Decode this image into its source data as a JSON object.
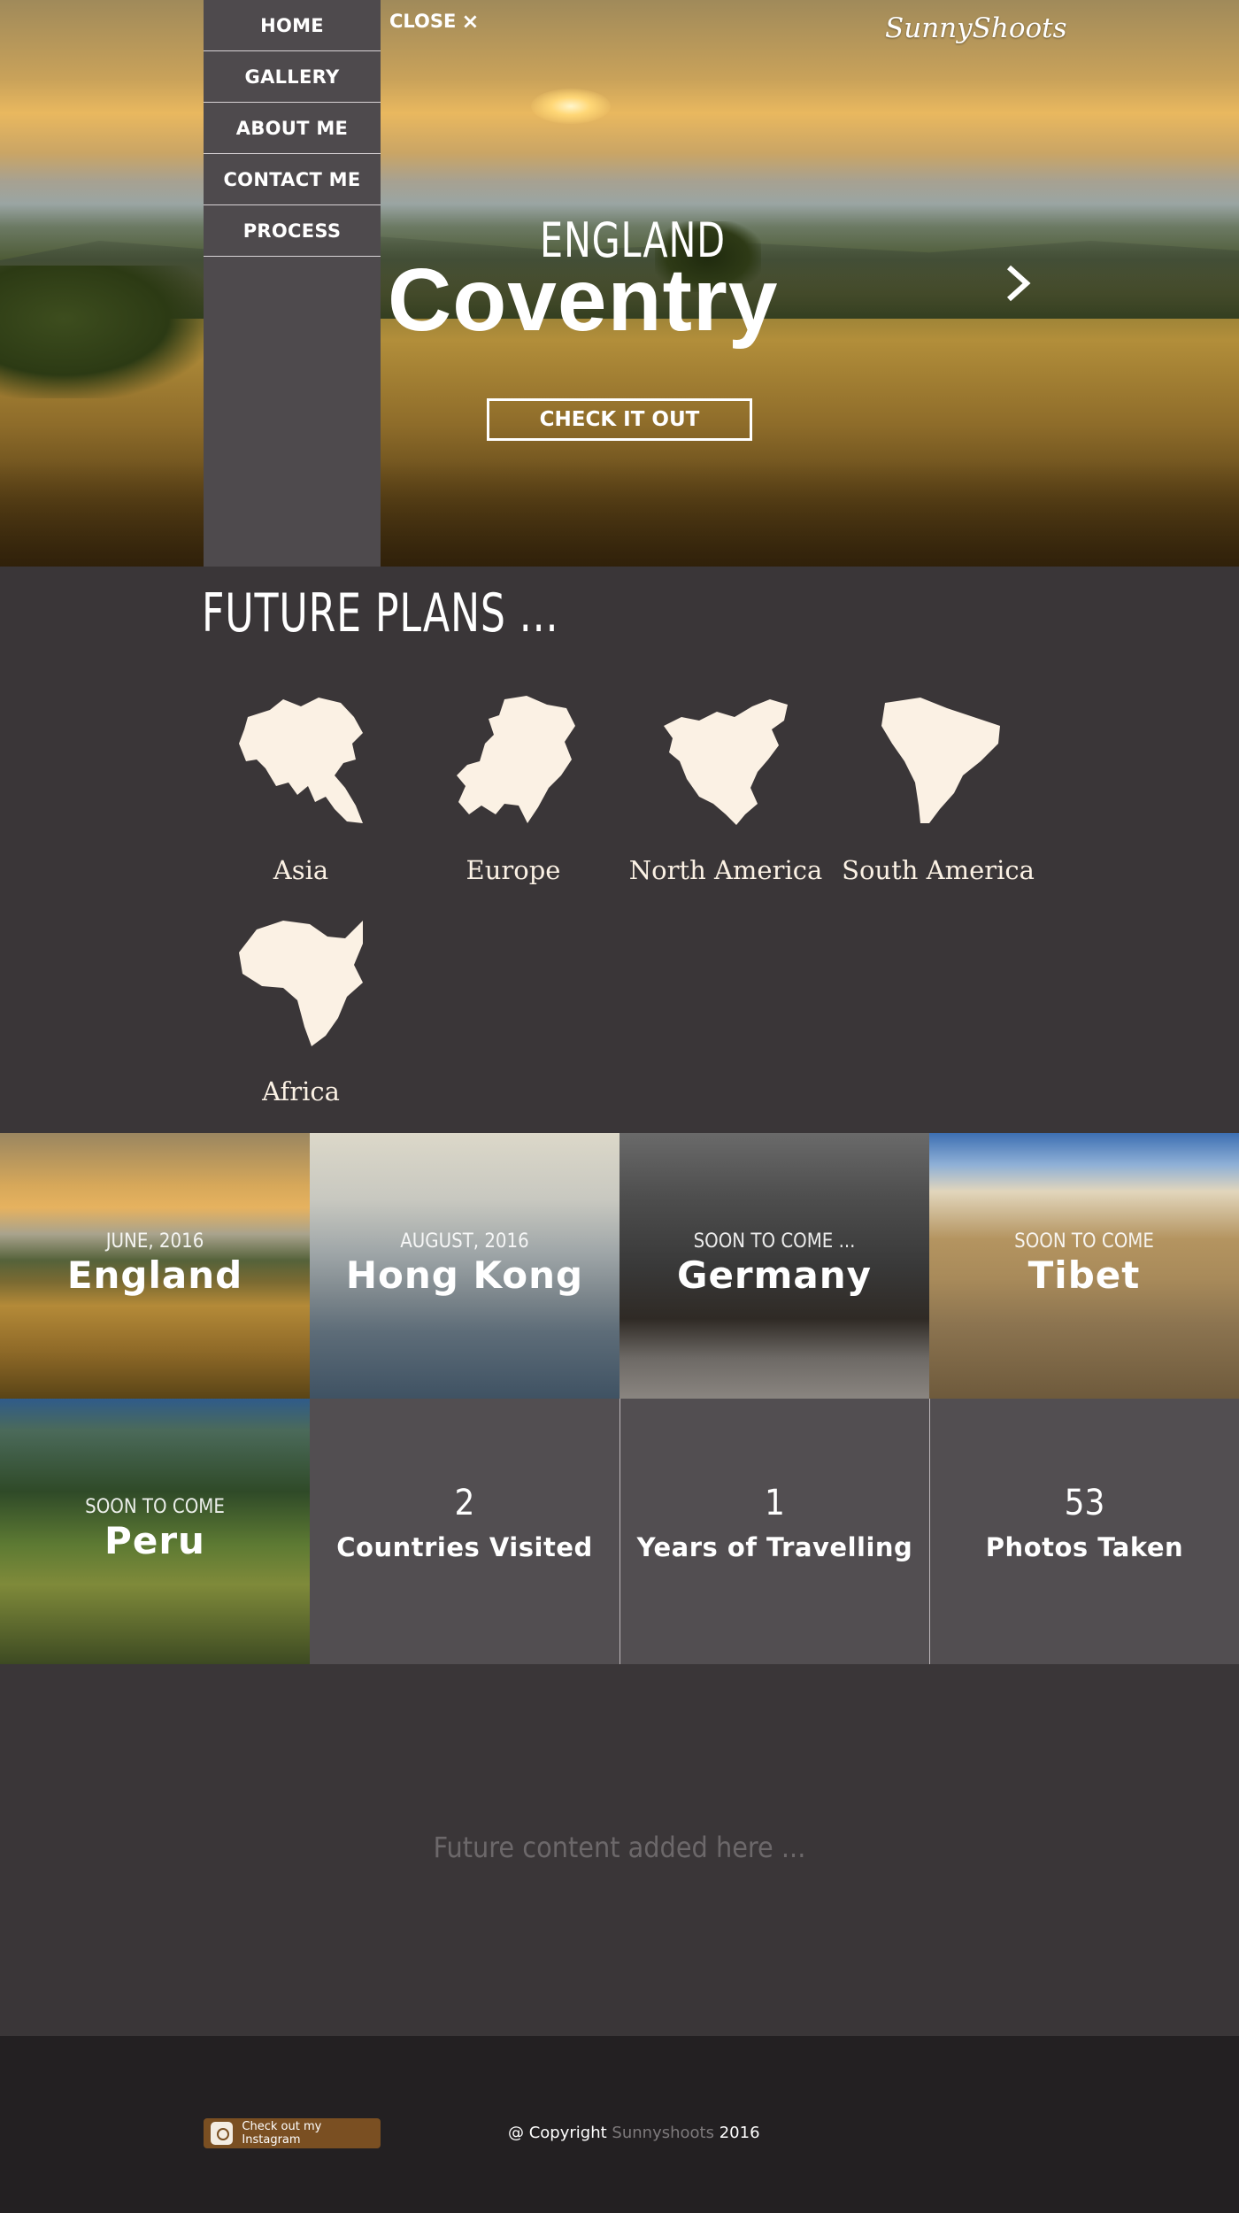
{
  "nav": {
    "items": [
      "HOME",
      "GALLERY",
      "ABOUT ME",
      "CONTACT ME",
      "PROCESS"
    ],
    "close_label": "CLOSE",
    "close_icon": "×"
  },
  "brand": {
    "logo": "SunnyShoots"
  },
  "hero": {
    "country": "ENGLAND",
    "city": "Coventry",
    "cta": "CHECK IT OUT"
  },
  "plans": {
    "title": "FUTURE PLANS ...",
    "continents": [
      "Asia",
      "Europe",
      "North America",
      "South America",
      "Africa"
    ]
  },
  "gallery": [
    {
      "date": "JUNE, 2016",
      "name": "England"
    },
    {
      "date": "AUGUST, 2016",
      "name": "Hong Kong"
    },
    {
      "date": "SOON TO COME ...",
      "name": "Germany"
    },
    {
      "date": "SOON TO COME",
      "name": "Tibet"
    },
    {
      "date": "SOON TO COME",
      "name": "Peru"
    }
  ],
  "stats": [
    {
      "value": "2",
      "label": "Countries Visited"
    },
    {
      "value": "1",
      "label": "Years of Travelling"
    },
    {
      "value": "53",
      "label": "Photos Taken"
    }
  ],
  "future": {
    "text": "Future content added here ..."
  },
  "footer": {
    "instagram_label": "Check out my Instagram",
    "copyright_prefix": "@ Copyright",
    "copyright_brand": "Sunnyshoots",
    "copyright_year": "2016"
  },
  "colors": {
    "accent_brown": "#7a4f22",
    "menu_bg": "#4e4a4d",
    "page_bg": "#3a3638",
    "continent_fill": "#fbf1e4"
  }
}
